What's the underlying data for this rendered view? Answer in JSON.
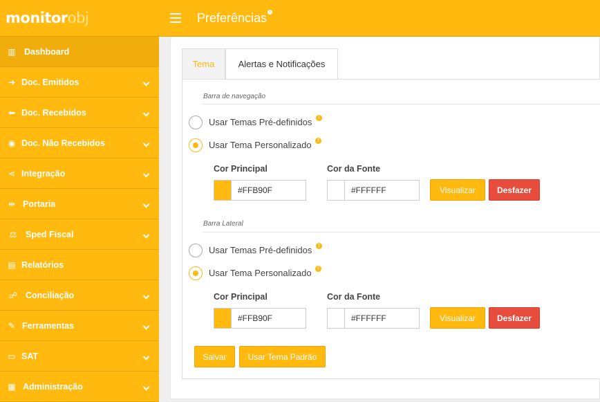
{
  "app": {
    "logo_primary": "monitor",
    "logo_secondary": "obj",
    "page_title": "Preferências",
    "title_info": "i"
  },
  "sidebar": {
    "items": [
      {
        "label": "Dashboard",
        "icon": "bar-chart-icon",
        "glyph": "▥",
        "active": true,
        "expandable": false
      },
      {
        "label": "Doc. Emitidos",
        "icon": "arrow-right-circle-icon",
        "glyph": "➔",
        "active": false,
        "expandable": true
      },
      {
        "label": "Doc. Recebidos",
        "icon": "arrow-left-circle-icon",
        "glyph": "⬅",
        "active": false,
        "expandable": true
      },
      {
        "label": "Doc. Não Recebidos",
        "icon": "dot-circle-icon",
        "glyph": "◉",
        "active": false,
        "expandable": true
      },
      {
        "label": "Integração",
        "icon": "share-icon",
        "glyph": "⋖",
        "active": false,
        "expandable": true
      },
      {
        "label": "Portaria",
        "icon": "signpost-icon",
        "glyph": "⇹",
        "active": false,
        "expandable": true
      },
      {
        "label": "Sped Fiscal",
        "icon": "balance-scale-icon",
        "glyph": "⚖",
        "active": false,
        "expandable": true
      },
      {
        "label": "Relatórios",
        "icon": "document-icon",
        "glyph": "▤",
        "active": false,
        "expandable": false
      },
      {
        "label": "Conciliação",
        "icon": "handshake-icon",
        "glyph": "☍",
        "active": false,
        "expandable": true
      },
      {
        "label": "Ferramentas",
        "icon": "wrench-icon",
        "glyph": "✎",
        "active": false,
        "expandable": true
      },
      {
        "label": "SAT",
        "icon": "printer-icon",
        "glyph": "▭",
        "active": false,
        "expandable": true
      },
      {
        "label": "Administração",
        "icon": "briefcase-icon",
        "glyph": "▦",
        "active": false,
        "expandable": true
      }
    ]
  },
  "tabs": [
    {
      "label": "Tema",
      "active": true
    },
    {
      "label": "Alertas e Notificações",
      "active": false
    }
  ],
  "nav_section": {
    "title": "Barra de navegação",
    "option_predefined": "Usar Temas Pré-definidos",
    "option_custom": "Usar Tema Personalizado",
    "selected": "custom",
    "main_color_label": "Cor Principal",
    "main_color_value": "#FFB90F",
    "font_color_label": "Cor da Fonte",
    "font_color_value": "#FFFFFF",
    "preview_label": "Visualizar",
    "undo_label": "Desfazer"
  },
  "side_section": {
    "title": "Barra Lateral",
    "option_predefined": "Usar Temas Pré-definidos",
    "option_custom": "Usar Tema Personalizado",
    "selected": "custom",
    "main_color_label": "Cor Principal",
    "main_color_value": "#FFB90F",
    "font_color_label": "Cor da Fonte",
    "font_color_value": "#FFFFFF",
    "preview_label": "Visualizar",
    "undo_label": "Desfazer"
  },
  "footer": {
    "save_label": "Salvar",
    "default_theme_label": "Usar Tema Padrão"
  },
  "colors": {
    "accent": "#FFB90F",
    "danger": "#E84C3D",
    "font": "#FFFFFF"
  }
}
